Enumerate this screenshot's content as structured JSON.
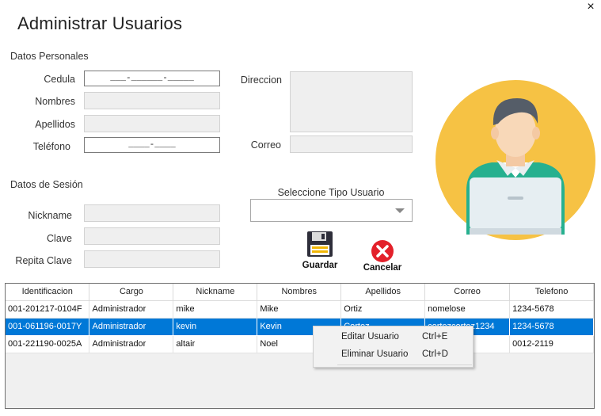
{
  "window": {
    "title": "Administrar Usuarios",
    "close_glyph": "×"
  },
  "personal": {
    "section_label": "Datos Personales",
    "cedula_label": "Cedula",
    "cedula_mask": "___-______-_____",
    "nombres_label": "Nombres",
    "apellidos_label": "Apellidos",
    "telefono_label": "Teléfono",
    "telefono_mask": "____-____",
    "direccion_label": "Direccion",
    "correo_label": "Correo"
  },
  "session": {
    "section_label": "Datos de Sesión",
    "nickname_label": "Nickname",
    "clave_label": "Clave",
    "repita_label": "Repita Clave",
    "tipo_label": "Seleccione Tipo Usuario",
    "tipo_value": ""
  },
  "buttons": {
    "guardar": "Guardar",
    "cancelar": "Cancelar"
  },
  "icons": {
    "save": "floppy-disk-icon",
    "cancel": "red-x-circle-icon",
    "avatar": "user-laptop-avatar-icon",
    "combo_arrow": "chevron-down-icon"
  },
  "colors": {
    "selection": "#0078d7",
    "avatar_bg": "#f6c244",
    "shirt": "#26b08f",
    "cancel": "#e3202a"
  },
  "grid": {
    "columns": [
      "Identificacion",
      "Cargo",
      "Nickname",
      "Nombres",
      "Apellidos",
      "Correo",
      "Telefono"
    ],
    "rows": [
      [
        "001-201217-0104F",
        "Administrador",
        "mike",
        "Mike",
        "Ortiz",
        "nomelose",
        "1234-5678"
      ],
      [
        "001-061196-0017Y",
        "Administrador",
        "kevin",
        "Kevin",
        "Cortez",
        "cortezcortez1234",
        "1234-5678"
      ],
      [
        "001-221190-0025A",
        "Administrador",
        "altair",
        "Noel",
        "",
        "",
        "0012-2119"
      ]
    ],
    "selected_row": 1
  },
  "context_menu": {
    "items": [
      {
        "label": "Editar Usuario",
        "shortcut": "Ctrl+E"
      },
      {
        "label": "Eliminar Usuario",
        "shortcut": "Ctrl+D"
      }
    ]
  }
}
